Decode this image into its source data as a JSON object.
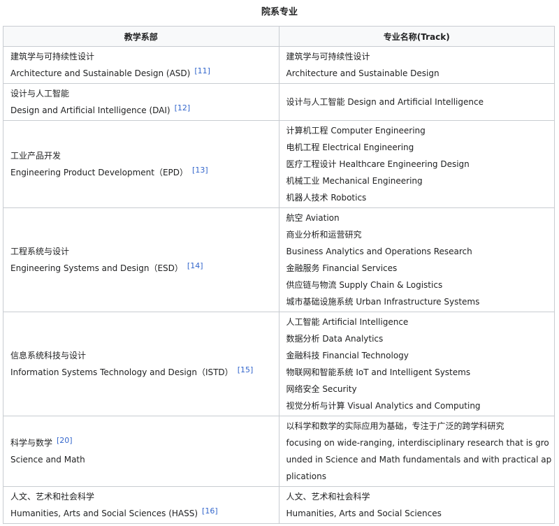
{
  "caption": "院系专业",
  "headers": {
    "dept": "教学系部",
    "track": "专业名称(Track)"
  },
  "rows": [
    {
      "zh": "建筑学与可持续性设计",
      "en": "Architecture and Sustainable Design (ASD)",
      "ref": "[11]",
      "tracks": [
        "建筑学与可持续性设计",
        "Architecture and Sustainable Design"
      ]
    },
    {
      "zh": "设计与人工智能",
      "en": "Design and Artificial Intelligence (DAI)",
      "ref": "[12]",
      "tracks": [
        "设计与人工智能 Design and Artificial Intelligence"
      ]
    },
    {
      "zh": "工业产品开发",
      "en": "Engineering Product Development（EPD）",
      "ref": "[13]",
      "tracks": [
        "计算机工程 Computer Engineering",
        "电机工程 Electrical Engineering",
        "医疗工程设计 Healthcare Engineering Design",
        "机械工业 Mechanical Engineering",
        "机器人技术 Robotics"
      ]
    },
    {
      "zh": "工程系统与设计",
      "en": "Engineering Systems and Design（ESD）",
      "ref": "[14]",
      "tracks": [
        "航空 Aviation",
        "商业分析和运营研究",
        "Business Analytics and Operations Research",
        "金融服务 Financial Services",
        "供应链与物流 Supply Chain & Logistics",
        "城市基础设施系统 Urban Infrastructure Systems"
      ]
    },
    {
      "zh": "信息系统科技与设计",
      "en": "Information Systems Technology and Design（ISTD）",
      "ref": "[15]",
      "tracks": [
        "人工智能 Artificial Intelligence",
        "数据分析 Data Analytics",
        "金融科技 Financial Technology",
        "物联网和智能系统 IoT and Intelligent Systems",
        "网络安全 Security",
        "视觉分析与计算 Visual Analytics and Computing"
      ]
    },
    {
      "zh": "科学与数学",
      "en": "Science and Math",
      "ref": "[20]",
      "tracks": [
        "以科学和数学的实际应用为基础，专注于广泛的跨学科研究",
        "focusing on wide-ranging, interdisciplinary research that is gro",
        "unded in Science and Math fundamentals and with practical ap",
        "plications"
      ]
    },
    {
      "zh": "人文、艺术和社会科学",
      "en": "Humanities, Arts and Social Sciences (HASS)",
      "ref": "[16]",
      "tracks": [
        "人文、艺术和社会科学",
        "Humanities, Arts and Social Sciences"
      ]
    }
  ]
}
